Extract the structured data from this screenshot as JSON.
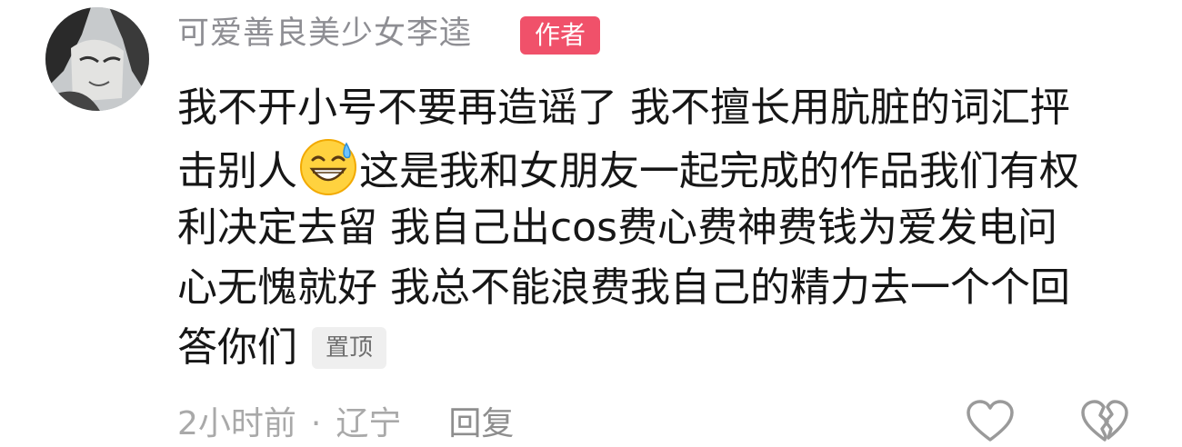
{
  "comment": {
    "author": "可爱善良美少女李逵",
    "author_badge": "作者",
    "lines": [
      "我不开小号不要再造谣了 我不擅长用肮脏的词汇抨",
      "击别人",
      "这是我和女朋友一起完成的作品我们有权",
      "利决定去留 我自己出cos费心费神费钱为爱发电问",
      "心无愧就好 我总不能浪费我自己的精力去一个个回",
      "答你们"
    ],
    "inline_emoji": "grinning-sweat-emoji",
    "pinned_label": "置顶",
    "time": "2小时前",
    "separator": "·",
    "location": "辽宁",
    "reply_label": "回复"
  },
  "icons": {
    "like": "heart-outline-icon",
    "dislike": "broken-heart-icon"
  },
  "colors": {
    "badge_bg": "#f0516a",
    "username": "#8e8e93",
    "text": "#161616",
    "meta": "#a9a9a9"
  }
}
